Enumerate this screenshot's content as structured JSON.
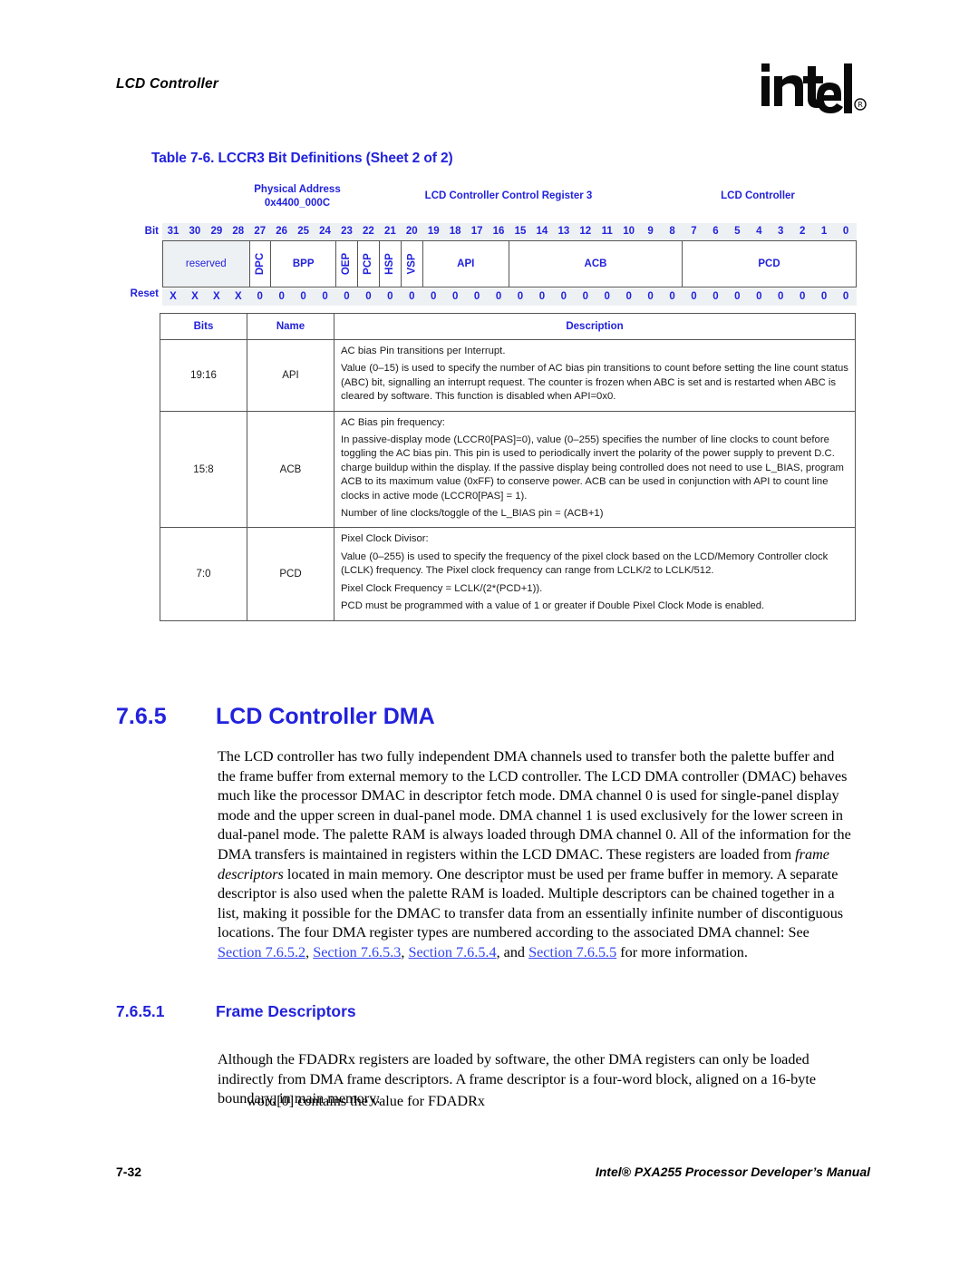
{
  "page": {
    "running_head": "LCD Controller",
    "logo_alt": "intel",
    "footer_page_number": "7-32",
    "footer_manual": "Intel® PXA255 Processor Developer’s Manual"
  },
  "table": {
    "caption": "Table 7-6. LCCR3 Bit Definitions (Sheet 2 of 2)",
    "register_header": {
      "physical_address_label": "Physical Address",
      "physical_address_value": "0x4400_000C",
      "register_name": "LCD Controller Control Register 3",
      "unit_name": "LCD Controller"
    },
    "bit_diagram": {
      "bit_row_label": "Bit",
      "reset_row_label": "Reset",
      "bit_numbers": [
        "31",
        "30",
        "29",
        "28",
        "27",
        "26",
        "25",
        "24",
        "23",
        "22",
        "21",
        "20",
        "19",
        "18",
        "17",
        "16",
        "15",
        "14",
        "13",
        "12",
        "11",
        "10",
        "9",
        "8",
        "7",
        "6",
        "5",
        "4",
        "3",
        "2",
        "1",
        "0"
      ],
      "reset_values": [
        "X",
        "X",
        "X",
        "X",
        "0",
        "0",
        "0",
        "0",
        "0",
        "0",
        "0",
        "0",
        "0",
        "0",
        "0",
        "0",
        "0",
        "0",
        "0",
        "0",
        "0",
        "0",
        "0",
        "0",
        "0",
        "0",
        "0",
        "0",
        "0",
        "0",
        "0",
        "0"
      ],
      "fields": [
        {
          "name": "reserved",
          "width": 4,
          "orientation": "horizontal",
          "shaded": true
        },
        {
          "name": "DPC",
          "width": 1,
          "orientation": "vertical",
          "shaded": false
        },
        {
          "name": "BPP",
          "width": 3,
          "orientation": "horizontal",
          "shaded": false
        },
        {
          "name": "OEP",
          "width": 1,
          "orientation": "vertical",
          "shaded": false
        },
        {
          "name": "PCP",
          "width": 1,
          "orientation": "vertical",
          "shaded": false
        },
        {
          "name": "HSP",
          "width": 1,
          "orientation": "vertical",
          "shaded": false
        },
        {
          "name": "VSP",
          "width": 1,
          "orientation": "vertical",
          "shaded": false
        },
        {
          "name": "API",
          "width": 4,
          "orientation": "horizontal",
          "shaded": false
        },
        {
          "name": "ACB",
          "width": 8,
          "orientation": "horizontal",
          "shaded": false
        },
        {
          "name": "PCD",
          "width": 8,
          "orientation": "horizontal",
          "shaded": false
        }
      ]
    },
    "columns": [
      "Bits",
      "Name",
      "Description"
    ],
    "rows": [
      {
        "bits": "19:16",
        "name": "API",
        "description": [
          "AC bias Pin transitions per Interrupt.",
          "Value (0–15) is used to specify the number of AC bias pin transitions to count before setting the line count status (ABC) bit, signalling an interrupt request. The counter is frozen when ABC is set and is restarted when ABC is cleared by software. This function is disabled when API=0x0."
        ]
      },
      {
        "bits": "15:8",
        "name": "ACB",
        "description": [
          "AC Bias pin frequency:",
          "In passive-display mode (LCCR0[PAS]=0), value (0–255) specifies the number of line clocks to count before toggling the AC bias pin. This pin is used to periodically invert the polarity of the power supply to prevent D.C. charge buildup within the display. If the passive display being controlled does not need to use L_BIAS, program ACB to its maximum value (0xFF) to conserve power. ACB can be used in conjunction with API to count line clocks in active mode (LCCR0[PAS] = 1).",
          "Number of line clocks/toggle of the L_BIAS pin = (ACB+1)"
        ]
      },
      {
        "bits": "7:0",
        "name": "PCD",
        "description": [
          "Pixel Clock Divisor:",
          "Value (0–255) is used to specify the frequency of the pixel clock based on the LCD/Memory Controller clock (LCLK) frequency. The Pixel clock frequency can range from LCLK/2 to LCLK/512.",
          "Pixel Clock Frequency = LCLK/(2*(PCD+1)).",
          "PCD must be programmed with a value of 1 or greater if Double Pixel Clock Mode is enabled."
        ]
      }
    ]
  },
  "sections": {
    "dma": {
      "number": "7.6.5",
      "title": "LCD Controller DMA",
      "paragraph_part1": "The LCD controller has two fully independent DMA channels used to transfer both the palette buffer and the frame buffer from external memory to the LCD controller. The LCD DMA controller (DMAC) behaves much like the processor DMAC in descriptor fetch mode. DMA channel 0 is used for single-panel display mode and the upper screen in dual-panel mode. DMA channel 1 is used exclusively for the lower screen in dual-panel mode. The palette RAM is always loaded through DMA channel 0. All of the information for the DMA transfers is maintained in registers within the LCD DMAC. These registers are loaded from ",
      "paragraph_italic": "frame descriptors",
      "paragraph_part2": " located in main memory. One descriptor must be used per frame buffer in memory. A separate descriptor is also used when the palette RAM is loaded. Multiple descriptors can be chained together in a list, making it possible for the DMAC to transfer data from an essentially infinite number of discontiguous locations. The four DMA register types are numbered according to the associated DMA channel: See ",
      "xref1": "Section 7.6.5.2",
      "sep1": ", ",
      "xref2": "Section 7.6.5.3",
      "sep2": ", ",
      "xref3": "Section 7.6.5.4",
      "sep3": ", and ",
      "xref4": "Section 7.6.5.5",
      "paragraph_part3": " for more information."
    },
    "frame_descriptors": {
      "number": "7.6.5.1",
      "title": "Frame Descriptors",
      "paragraph": "Although the FDADRx registers are loaded by software, the other DMA registers can only be loaded indirectly from DMA frame descriptors. A frame descriptor is a four-word block, aligned on a 16-byte boundary, in main memory:",
      "word_line": "word[0] contains the value for FDADRx"
    }
  },
  "colors": {
    "heading_blue": "#2222dd",
    "link_blue": "#3344ee",
    "rule_gray": "#555555",
    "shade_gray": "#eef1f4"
  }
}
